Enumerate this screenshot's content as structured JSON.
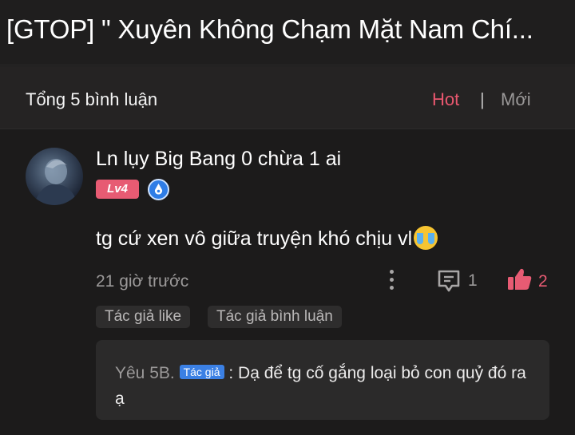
{
  "header": {
    "title": "[GTOP] \" Xuyên Không Chạm Mặt Nam Chí..."
  },
  "comments_summary": {
    "total": "Tổng 5 bình luận",
    "sort_hot": "Hot",
    "sort_divider": "|",
    "sort_new": "Mới",
    "active_sort_color": "#e9576f"
  },
  "comment": {
    "username": "Ln lụy Big Bang 0 chừa 1 ai",
    "level": "Lv4",
    "text": "tg cứ xen vô giữa truyện khó chịu vl",
    "emoji": "loudly-crying-face",
    "time": "21 giờ trước",
    "reply_count": "1",
    "like_count": "2",
    "tags": [
      "Tác giả like",
      "Tác giả bình luận"
    ],
    "reply": {
      "author": "Yêu 5B.",
      "author_badge": "Tác giả",
      "separator": ":",
      "text": "Dạ để tg cố gắng loại bỏ con quỷ đó ra ạ"
    }
  },
  "colors": {
    "background": "#1c1b1b",
    "accent_pink": "#e75b73",
    "badge_blue": "#3b80e4"
  }
}
